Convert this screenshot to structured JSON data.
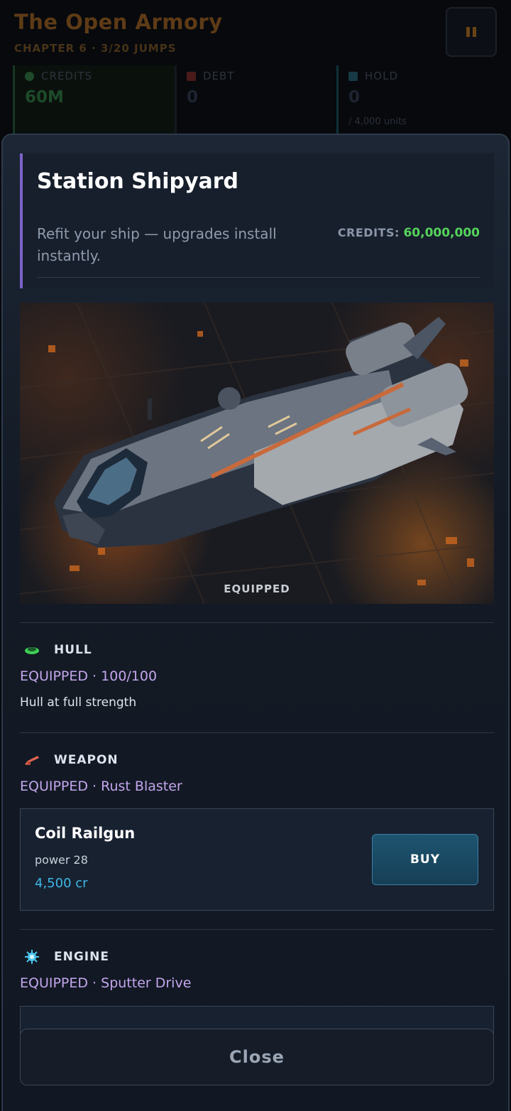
{
  "hud": {
    "title": "The Open Armory",
    "subtitle": "CHAPTER 6 · 3/20 JUMPS",
    "stats": [
      {
        "label": "CREDITS",
        "value": "60M",
        "note": ""
      },
      {
        "label": "DEBT",
        "value": "0",
        "note": ""
      },
      {
        "label": "HOLD",
        "value": "0",
        "note": "/ 4,000 units"
      }
    ]
  },
  "shipyard": {
    "title": "Station Shipyard",
    "description": "Refit your ship — upgrades install instantly.",
    "credits_label": "CREDITS:",
    "credits_value": "60,000,000",
    "ship_caption": "EQUIPPED"
  },
  "sections": {
    "hull": {
      "title": "HULL",
      "status": "EQUIPPED · 100/100",
      "note": "Hull at full strength"
    },
    "weapon": {
      "title": "WEAPON",
      "status": "EQUIPPED · Rust Blaster"
    },
    "engine": {
      "title": "ENGINE",
      "status": "EQUIPPED · Sputter Drive"
    }
  },
  "offer": {
    "name": "Coil Railgun",
    "stat": "power 28",
    "price": "4,500 cr",
    "buy_label": "BUY"
  },
  "close_label": "Close",
  "colors": {
    "accent_purple": "#7d62c9",
    "credits_green": "#56d35c",
    "price_blue": "#3fb7e6",
    "status_lavender": "#c3a6ec"
  },
  "icons": {
    "hull": "hull-icon",
    "weapon": "weapon-icon",
    "engine": "engine-icon",
    "pause": "pause-icon"
  }
}
